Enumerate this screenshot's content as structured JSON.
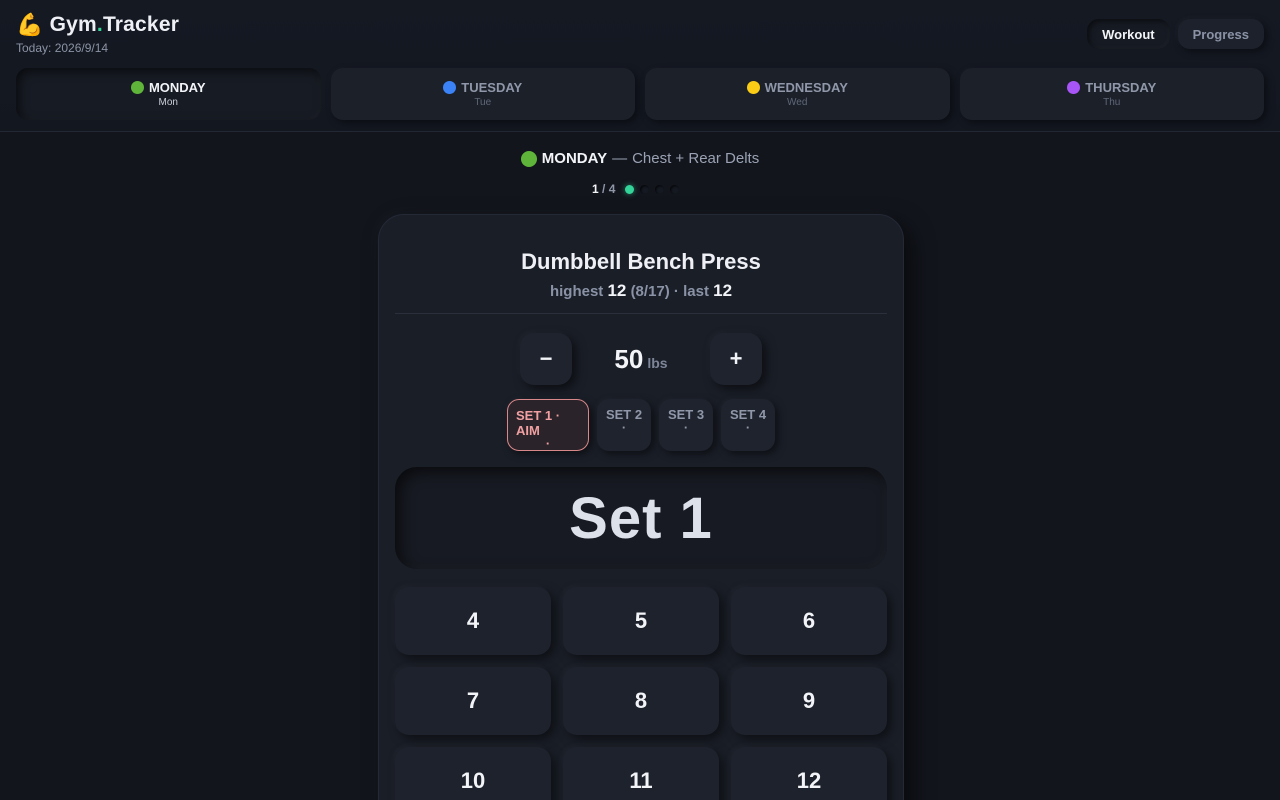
{
  "app": {
    "title_prefix": "Gym",
    "title_dot": ".",
    "title_suffix": "Tracker",
    "emoji": "💪",
    "today": "Today: 2026/9/14"
  },
  "nav": {
    "workout_label": "Workout",
    "progress_label": "Progress"
  },
  "days": [
    {
      "name": "MONDAY",
      "short": "Mon",
      "color": "#5fb53a"
    },
    {
      "name": "TUESDAY",
      "short": "Tue",
      "color": "#3b82f6"
    },
    {
      "name": "WEDNESDAY",
      "short": "Wed",
      "color": "#facc15"
    },
    {
      "name": "THURSDAY",
      "short": "Thu",
      "color": "#a855f7"
    }
  ],
  "workout": {
    "day": "MONDAY",
    "separator": "—",
    "focus": "Chest + Rear Delts"
  },
  "progress": {
    "current": "1",
    "sep": "/",
    "total": "4",
    "accent": "#34d399"
  },
  "exercise": {
    "name": "Dumbbell Bench Press",
    "highest_label": "highest",
    "highest_value": "12",
    "highest_date": "(8/17)",
    "dot": "·",
    "last_label": "last",
    "last_value": "12"
  },
  "weight": {
    "minus": "−",
    "plus": "+",
    "value": "50",
    "unit": "lbs"
  },
  "sets": [
    {
      "label": "SET 1 · AIM",
      "value": "·"
    },
    {
      "label": "SET 2",
      "value": "·"
    },
    {
      "label": "SET 3",
      "value": "·"
    },
    {
      "label": "SET 4",
      "value": "·"
    }
  ],
  "display": "Set 1",
  "keypad": [
    "4",
    "5",
    "6",
    "7",
    "8",
    "9",
    "10",
    "11",
    "12"
  ]
}
